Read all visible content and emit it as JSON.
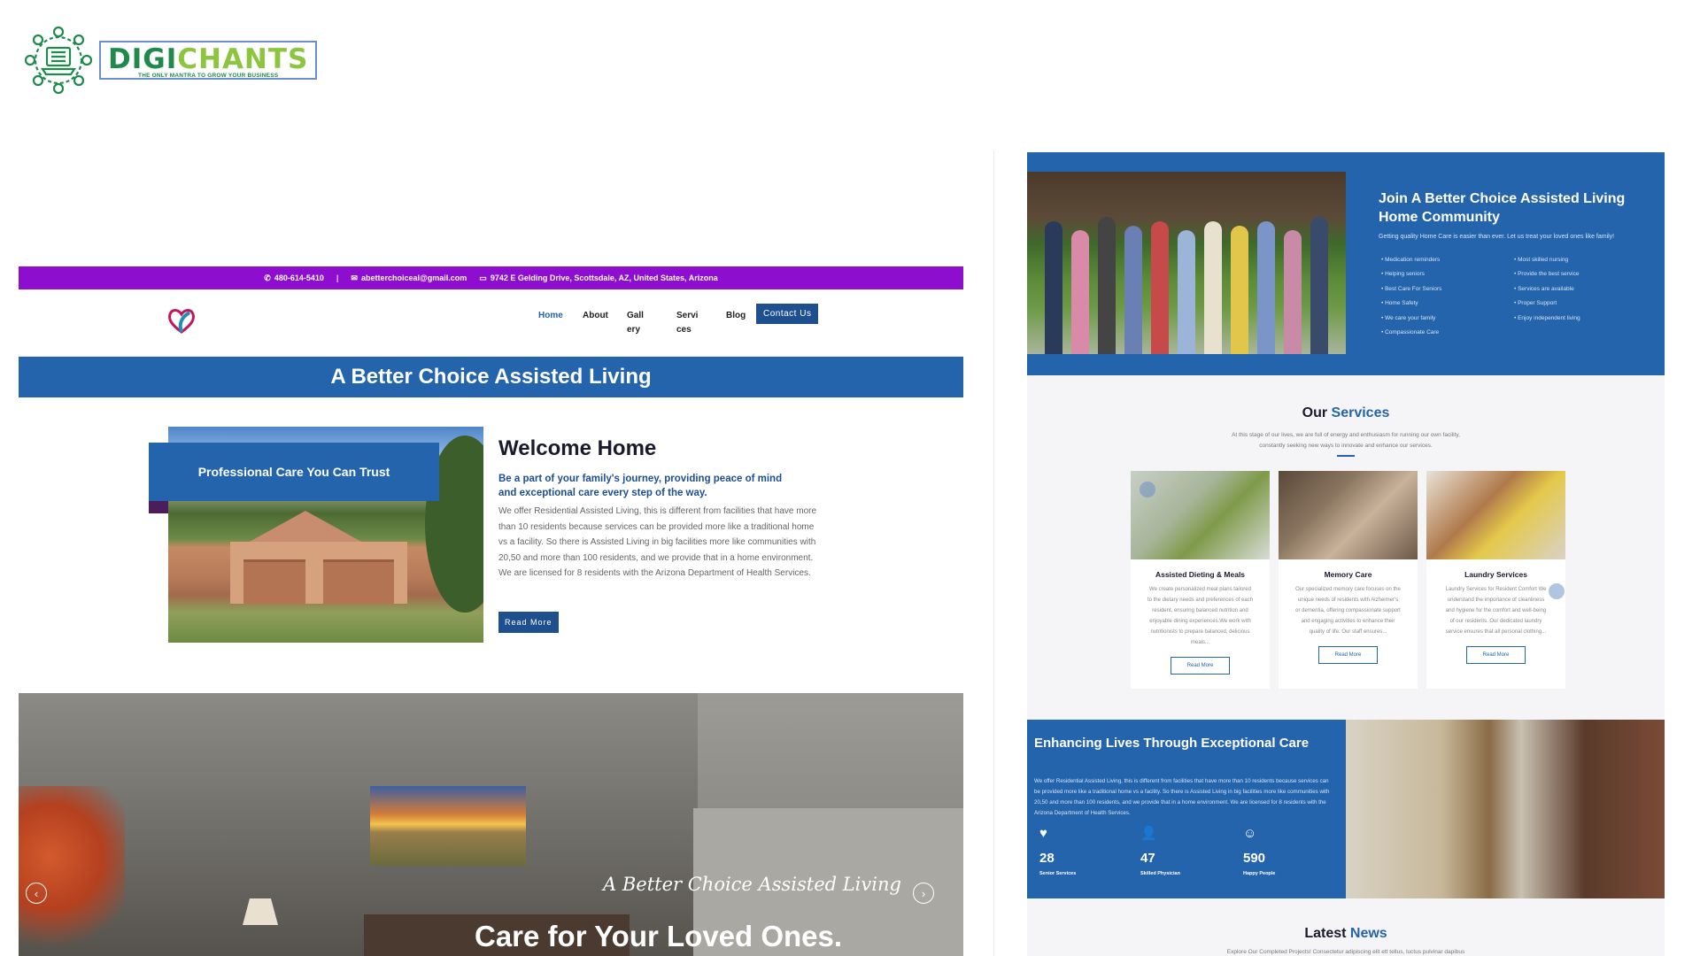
{
  "brand": {
    "name_part1": "DIGI",
    "name_part2": "CHANTS",
    "tagline": "THE ONLY MANTRA TO GROW YOUR BUSINESS"
  },
  "left_site": {
    "topbar": {
      "phone": "480-614-5410",
      "separator": "|",
      "email": "abetterchoiceal@gmail.com",
      "address": "9742 E Gelding Drive, Scottsdale, AZ, United States, Arizona"
    },
    "nav": {
      "home": "Home",
      "about": "About",
      "gallery": "Gall ery",
      "services": "Servi ces",
      "blog": "Blog",
      "contact": "Contact Us"
    },
    "hero_band": "A Better Choice Assisted Living",
    "welcome": {
      "badge": "Professional Care You Can Trust",
      "title": "Welcome Home",
      "lead": "Be a part of your family's journey, providing peace of mind and exceptional care every step of the way.",
      "body": "We offer Residential Assisted Living, this is different from facilities that have more than 10 residents because services can be provided more like a traditional home vs a facility. So there is Assisted Living in big facilities more like communities with 20,50 and more than 100 residents, and we provide that in a home environment. We are licensed for 8 residents with the Arizona Department of Health Services.",
      "button": "Read More"
    },
    "slider": {
      "script": "A Better Choice Assisted Living",
      "title": "Care for Your Loved Ones.",
      "prev": "‹",
      "next": "›"
    }
  },
  "right_site": {
    "join": {
      "title": "Join A Better Choice Assisted Living Home Community",
      "subtitle": "Getting quality Home Care is easier than ever. Let us treat your loved ones like family!",
      "list_left": [
        "Medication reminders",
        "Helping seniors",
        "Best Care For Seniors",
        "Home Safety",
        "We care your family",
        "Compassionate Care"
      ],
      "list_right": [
        "Most skilled nursing",
        "Provide the best service",
        "Services are available",
        "Proper Support",
        "Enjoy independent living"
      ]
    },
    "services": {
      "title_a": "Our",
      "title_b": "Services",
      "subtitle_line1": "At this stage of our lives, we are full of energy and enthusiasm for running our own facility,",
      "subtitle_line2": "constantly seeking new ways to innovate and enhance our services.",
      "cards": [
        {
          "title": "Assisted Dieting & Meals",
          "desc": "We create personalized meal plans tailored to the dietary needs and preferences of each resident, ensuring balanced nutrition and enjoyable dining experiences.We work with nutritionists to prepare balanced, delicious meals...",
          "button": "Read More"
        },
        {
          "title": "Memory Care",
          "desc": "Our specialized memory care focuses on the unique needs of residents with Alzheimer's or dementia, offering compassionate support and engaging activities to enhance their quality of life. Our staff ensures...",
          "button": "Read More"
        },
        {
          "title": "Laundry Services",
          "desc": "Laundry Services for Resident Comfort We understand the importance of cleanliness and hygiene for the comfort and well-being of our residents. Our dedicated laundry service ensures that all personal clothing...",
          "button": "Read More"
        }
      ]
    },
    "enhancing": {
      "title": "Enhancing Lives Through Exceptional Care",
      "body": "We offer Residential Assisted Living, this is different from facilities that have more than 10 residents because services can be provided more like a traditional home vs a facility. So there is Assisted Living in big facilities more like communities with 20,50 and more than 100 residents, and we provide that in a home environment. We are licensed for 8 residents with the Arizona Department of Health Services.",
      "stats": [
        {
          "icon": "♥",
          "number": "28",
          "label": "Senior Services"
        },
        {
          "icon": "👤",
          "number": "47",
          "label": "Skilled Physician"
        },
        {
          "icon": "☺",
          "number": "590",
          "label": "Happy People"
        }
      ]
    },
    "news": {
      "title_a": "Latest",
      "title_b": "News",
      "subtitle": "Explore Our Completed Projects! Consectetur adipiscing elit ett tellus, luctus pulvinar dapibus"
    }
  },
  "colors": {
    "primary_blue": "#2364ad",
    "topbar_purple": "#8e0ecf",
    "brand_green": "#1f8a4c",
    "brand_lime": "#8cc63f"
  }
}
